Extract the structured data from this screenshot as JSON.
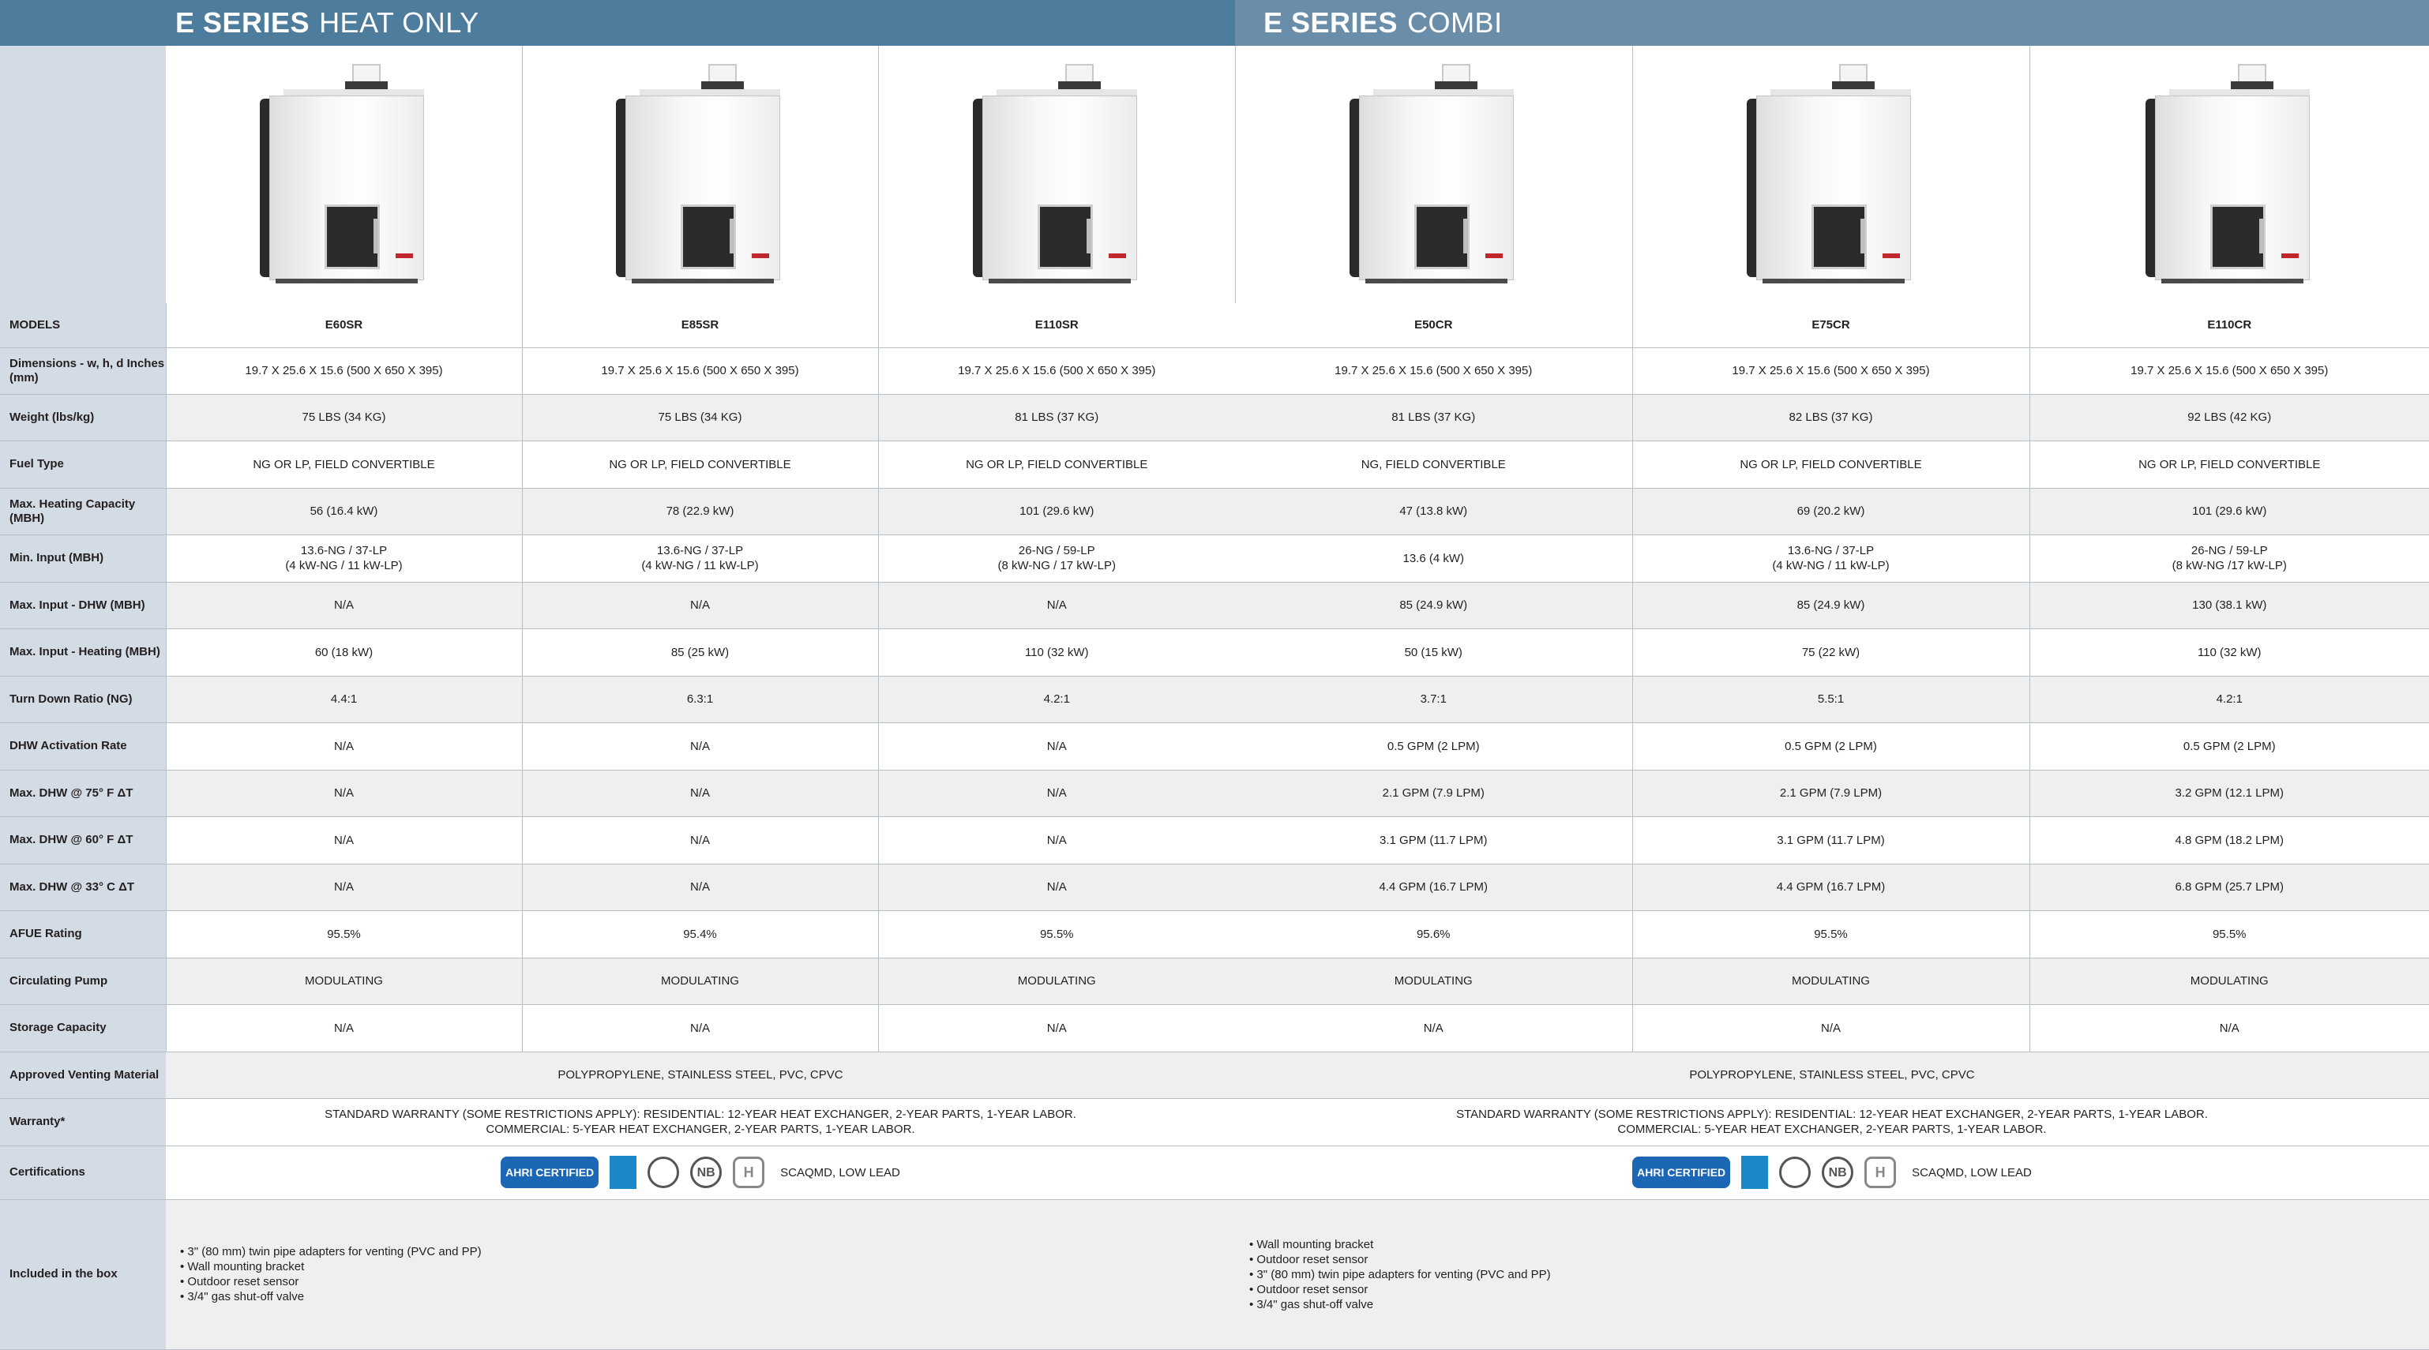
{
  "header": {
    "heat_only_bold": "E SERIES",
    "heat_only_rest": "HEAT ONLY",
    "combi_bold": "E SERIES",
    "combi_rest": "COMBI"
  },
  "rows": {
    "models": "MODELS",
    "dimensions": "Dimensions - w, h, d Inches (mm)",
    "weight": "Weight (lbs/kg)",
    "fuel": "Fuel Type",
    "max_heating_capacity": "Max. Heating Capacity (MBH)",
    "min_input": "Min. Input (MBH)",
    "max_input_dhw": "Max. Input - DHW (MBH)",
    "max_input_heating": "Max. Input - Heating (MBH)",
    "turn_down": "Turn Down Ratio (NG)",
    "dhw_activation": "DHW Activation Rate",
    "dhw_75": "Max. DHW @ 75° F ΔT",
    "dhw_60": "Max. DHW @ 60° F ΔT",
    "dhw_33": "Max. DHW @ 33° C ΔT",
    "afue": "AFUE Rating",
    "pump": "Circulating Pump",
    "storage": "Storage Capacity",
    "venting": "Approved Venting Material",
    "warranty": "Warranty*",
    "certs": "Certifications",
    "box": "Included in the box"
  },
  "products": [
    {
      "model": "E60SR",
      "dimensions": "19.7 X 25.6 X 15.6 (500 X 650 X 395)",
      "weight": "75 LBS (34 KG)",
      "fuel": "NG OR LP, FIELD CONVERTIBLE",
      "max_heating_capacity": "56 (16.4 kW)",
      "min_input_1": "13.6-NG / 37-LP",
      "min_input_2": "(4 kW-NG / 11 kW-LP)",
      "max_input_dhw": "N/A",
      "max_input_heating": "60 (18 kW)",
      "turn_down": "4.4:1",
      "dhw_activation": "N/A",
      "dhw_75": "N/A",
      "dhw_60": "N/A",
      "dhw_33": "N/A",
      "afue": "95.5%",
      "pump": "MODULATING",
      "storage": "N/A"
    },
    {
      "model": "E85SR",
      "dimensions": "19.7 X 25.6 X 15.6 (500 X 650 X 395)",
      "weight": "75 LBS (34 KG)",
      "fuel": "NG OR LP, FIELD CONVERTIBLE",
      "max_heating_capacity": "78 (22.9 kW)",
      "min_input_1": "13.6-NG / 37-LP",
      "min_input_2": "(4 kW-NG / 11 kW-LP)",
      "max_input_dhw": "N/A",
      "max_input_heating": "85 (25 kW)",
      "turn_down": "6.3:1",
      "dhw_activation": "N/A",
      "dhw_75": "N/A",
      "dhw_60": "N/A",
      "dhw_33": "N/A",
      "afue": "95.4%",
      "pump": "MODULATING",
      "storage": "N/A"
    },
    {
      "model": "E110SR",
      "dimensions": "19.7 X 25.6 X 15.6 (500 X 650 X 395)",
      "weight": "81 LBS (37 KG)",
      "fuel": "NG OR LP, FIELD CONVERTIBLE",
      "max_heating_capacity": "101 (29.6 kW)",
      "min_input_1": "26-NG / 59-LP",
      "min_input_2": "(8 kW-NG / 17 kW-LP)",
      "max_input_dhw": "N/A",
      "max_input_heating": "110 (32 kW)",
      "turn_down": "4.2:1",
      "dhw_activation": "N/A",
      "dhw_75": "N/A",
      "dhw_60": "N/A",
      "dhw_33": "N/A",
      "afue": "95.5%",
      "pump": "MODULATING",
      "storage": "N/A"
    },
    {
      "model": "E50CR",
      "dimensions": "19.7 X 25.6 X 15.6 (500 X 650 X 395)",
      "weight": "81 LBS (37 KG)",
      "fuel": "NG, FIELD CONVERTIBLE",
      "max_heating_capacity": "47 (13.8 kW)",
      "min_input_1": "13.6 (4 kW)",
      "min_input_2": "",
      "max_input_dhw": "85 (24.9 kW)",
      "max_input_heating": "50 (15 kW)",
      "turn_down": "3.7:1",
      "dhw_activation": "0.5 GPM (2 LPM)",
      "dhw_75": "2.1 GPM (7.9 LPM)",
      "dhw_60": "3.1 GPM (11.7 LPM)",
      "dhw_33": "4.4 GPM (16.7 LPM)",
      "afue": "95.6%",
      "pump": "MODULATING",
      "storage": "N/A"
    },
    {
      "model": "E75CR",
      "dimensions": "19.7 X 25.6 X 15.6 (500 X 650 X 395)",
      "weight": "82 LBS (37 KG)",
      "fuel": "NG OR LP, FIELD CONVERTIBLE",
      "max_heating_capacity": "69 (20.2 kW)",
      "min_input_1": "13.6-NG / 37-LP",
      "min_input_2": "(4 kW-NG / 11 kW-LP)",
      "max_input_dhw": "85 (24.9 kW)",
      "max_input_heating": "75 (22 kW)",
      "turn_down": "5.5:1",
      "dhw_activation": "0.5 GPM (2 LPM)",
      "dhw_75": "2.1 GPM (7.9 LPM)",
      "dhw_60": "3.1 GPM (11.7 LPM)",
      "dhw_33": "4.4 GPM (16.7 LPM)",
      "afue": "95.5%",
      "pump": "MODULATING",
      "storage": "N/A"
    },
    {
      "model": "E110CR",
      "dimensions": "19.7 X 25.6 X 15.6 (500 X 650 X 395)",
      "weight": "92 LBS (42 KG)",
      "fuel": "NG OR LP, FIELD CONVERTIBLE",
      "max_heating_capacity": "101 (29.6 kW)",
      "min_input_1": "26-NG / 59-LP",
      "min_input_2": "(8 kW-NG /17 kW-LP)",
      "max_input_dhw": "130 (38.1 kW)",
      "max_input_heating": "110 (32 kW)",
      "turn_down": "4.2:1",
      "dhw_activation": "0.5 GPM (2 LPM)",
      "dhw_75": "3.2 GPM (12.1 LPM)",
      "dhw_60": "4.8 GPM (18.2 LPM)",
      "dhw_33": "6.8 GPM (25.7 LPM)",
      "afue": "95.5%",
      "pump": "MODULATING",
      "storage": "N/A"
    }
  ],
  "groups": {
    "heat_only": {
      "venting": "POLYPROPYLENE, STAINLESS STEEL, PVC, CPVC",
      "warranty_1": "STANDARD WARRANTY (SOME RESTRICTIONS APPLY): RESIDENTIAL: 12-YEAR HEAT EXCHANGER, 2-YEAR PARTS, 1-YEAR LABOR.",
      "warranty_2": "COMMERCIAL: 5-YEAR HEAT EXCHANGER, 2-YEAR PARTS, 1-YEAR LABOR.",
      "cert_text": "SCAQMD, LOW LEAD",
      "box_items": [
        "• 3\" (80 mm) twin pipe adapters for venting (PVC and PP)",
        "• Wall mounting bracket",
        "• Outdoor reset sensor",
        "• 3/4\" gas shut-off valve"
      ]
    },
    "combi": {
      "venting": "POLYPROPYLENE, STAINLESS STEEL, PVC, CPVC",
      "warranty_1": "STANDARD WARRANTY (SOME RESTRICTIONS APPLY): RESIDENTIAL: 12-YEAR HEAT EXCHANGER, 2-YEAR PARTS, 1-YEAR LABOR.",
      "warranty_2": "COMMERCIAL: 5-YEAR HEAT EXCHANGER, 2-YEAR PARTS, 1-YEAR LABOR.",
      "cert_text": "SCAQMD, LOW LEAD",
      "box_items": [
        "• Wall mounting bracket",
        "• Outdoor reset sensor",
        "• 3\" (80 mm) twin pipe adapters for venting (PVC and PP)",
        "• Outdoor reset sensor",
        "• 3/4\" gas shut-off valve"
      ]
    }
  },
  "cert_logos": {
    "ahri_main": "AHRI CERTIFIED",
    "energy_star": "ENERGY STAR",
    "csa": "CSA",
    "nsf": "NB",
    "h_stamp": "H"
  },
  "icons": [
    "ahri-certified-icon",
    "energy-star-icon",
    "csa-icon",
    "nb-stamp-icon",
    "h-stamp-icon"
  ],
  "colors": {
    "header_heat": "#4d7c9c",
    "header_combi": "#6a8eaa",
    "label_col": "#d3dbe4"
  }
}
